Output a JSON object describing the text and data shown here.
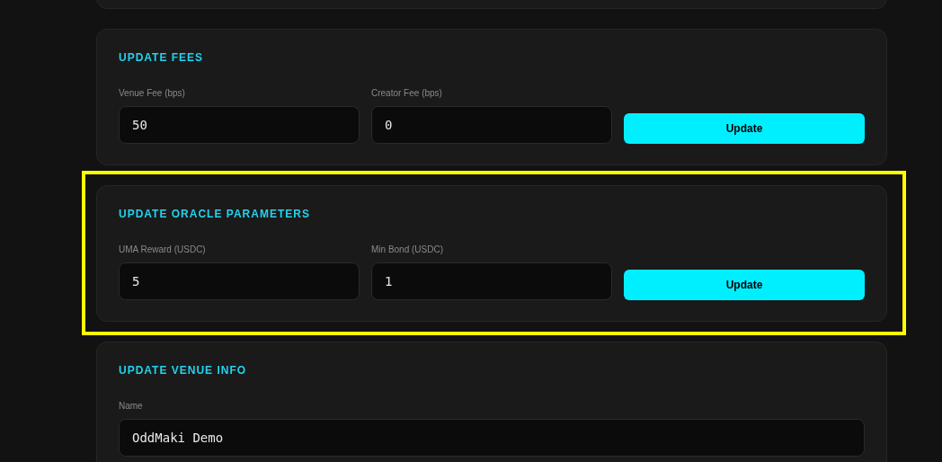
{
  "sections": [
    {
      "kind": "blank",
      "highlighted": false
    },
    {
      "kind": "row",
      "highlighted": false,
      "title": "UPDATE FEES",
      "fields": [
        {
          "label": "Venue Fee (bps)",
          "value": "50"
        },
        {
          "label": "Creator Fee (bps)",
          "value": "0"
        }
      ],
      "button": "Update"
    },
    {
      "kind": "row",
      "highlighted": true,
      "title": "UPDATE ORACLE PARAMETERS",
      "fields": [
        {
          "label": "UMA Reward (USDC)",
          "value": "5"
        },
        {
          "label": "Min Bond (USDC)",
          "value": "1"
        }
      ],
      "button": "Update"
    },
    {
      "kind": "stack",
      "highlighted": false,
      "title": "UPDATE VENUE INFO",
      "fields": [
        {
          "label": "Name",
          "value": "OddMaki Demo"
        }
      ]
    }
  ]
}
